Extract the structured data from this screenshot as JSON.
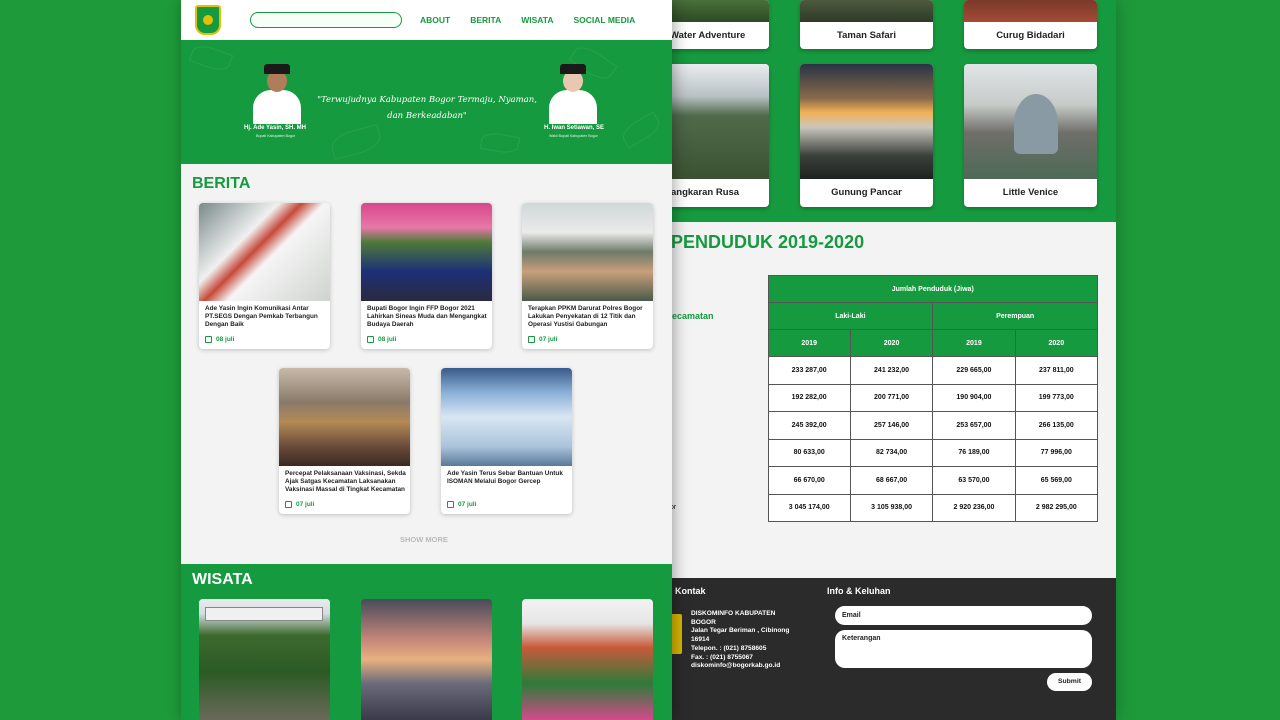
{
  "front": {
    "nav": {
      "search_placeholder": "",
      "menu": [
        "ABOUT",
        "BERITA",
        "WISATA",
        "SOCIAL MEDIA"
      ]
    },
    "hero": {
      "left_name": "Hj. Ade Yasin, SH. MH",
      "left_role": "Bupati Kabupaten Bogor",
      "right_name": "H. Iwan Setiawan, SE",
      "right_role": "Wakil Bupati Kabupaten Bogor",
      "quote": "\"Terwujudnya Kabupaten Bogor Termaju, Nyaman, dan Berkeadaban\""
    },
    "berita": {
      "title": "BERITA",
      "cards": [
        {
          "title": "Ade Yasin Ingin Komunikasi Antar PT.SEGS Dengan Pemkab Terbangun Dengan Baik",
          "date": "08 juli"
        },
        {
          "title": "Bupati Bogor Ingin FFP Bogor 2021 Lahirkan Sineas Muda dan Mengangkat Budaya Daerah",
          "date": "08 juli"
        },
        {
          "title": "Terapkan PPKM Darurat Polres Bogor Lakukan Penyekatan di 12 Titik dan Operasi Yustisi Gabungan",
          "date": "07 juli"
        },
        {
          "title": "Percepat Pelaksanaan Vaksinasi, Sekda Ajak Satgas Kecamatan Laksanakan Vaksinasi Massal di Tingkat Kecamatan",
          "date": "07 juli"
        },
        {
          "title": "Ade Yasin Terus Sebar Bantuan Untuk ISOMAN Melalui Bogor Gercep",
          "date": "07 juli"
        }
      ],
      "show_more": "SHOW MORE"
    },
    "wisata": {
      "title": "WISATA"
    }
  },
  "back": {
    "tiles_row1": [
      "gle Water Adventure",
      "Taman Safari",
      "Curug Bidadari"
    ],
    "tiles_row2": [
      "enangkaran Rusa",
      "Gunung Pancar",
      "Little Venice"
    ],
    "penduduk_title": "AH PENDUDUK 2019-2020",
    "table": {
      "head_jumlah": "Jumlah Penduduk (Jiwa)",
      "head_wilayah": "layah Kecamatan",
      "head_laki": "Laki-Laki",
      "head_perempuan": "Perempuan",
      "years": [
        "2019",
        "2020",
        "2019",
        "2020"
      ],
      "rows": [
        {
          "kec": "g",
          "v": [
            "233 287,00",
            "241 232,00",
            "229 665,00",
            "237 811,00"
          ]
        },
        {
          "kec": "",
          "v": [
            "192 282,00",
            "200 771,00",
            "190 904,00",
            "199 773,00"
          ]
        },
        {
          "kec": "g Putri",
          "v": [
            "245 392,00",
            "257 146,00",
            "253 657,00",
            "266 135,00"
          ]
        },
        {
          "kec": "",
          "v": [
            "80 633,00",
            "82 734,00",
            "76 189,00",
            "77 996,00"
          ]
        },
        {
          "kec": "unggal",
          "v": [
            "66 670,00",
            "68 667,00",
            "63 570,00",
            "65 569,00"
          ]
        },
        {
          "kec": "aten Bogor",
          "v": [
            "3 045 174,00",
            "3 105 938,00",
            "2 920 236,00",
            "2 982 295,00"
          ]
        }
      ]
    },
    "footer": {
      "kontak_title": "i Kontak",
      "info_title": "Info & Keluhan",
      "address_lines": [
        "DISKOMINFO KABUPATEN",
        "BOGOR",
        "Jalan Tegar Beriman , Cibinong",
        "16914",
        "Telepon. : (021) 8758605",
        "Fax. : (021) 8755067",
        "diskominfo@bogorkab.go.id"
      ],
      "email_placeholder": "Email",
      "keterangan_placeholder": "Keterangan",
      "submit": "Submit"
    }
  }
}
